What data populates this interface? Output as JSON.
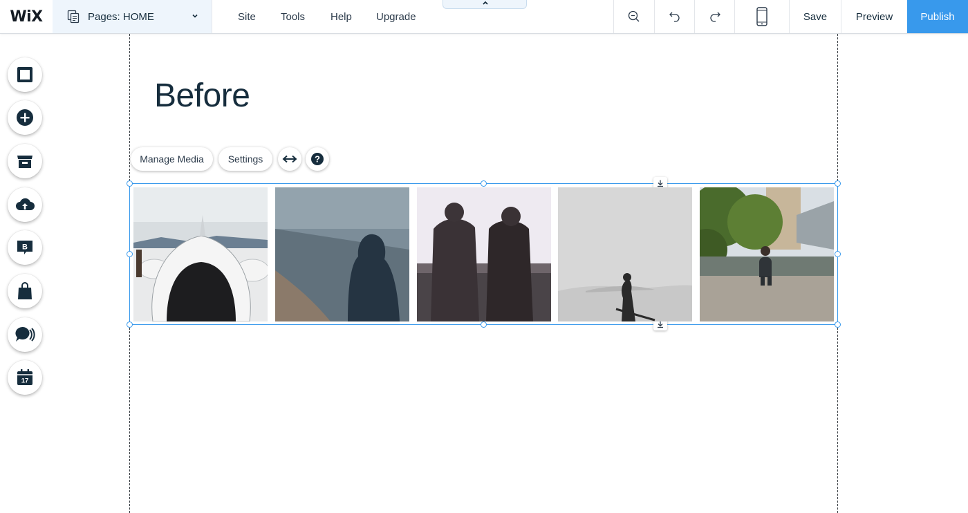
{
  "topbar": {
    "logo": "WiX",
    "pages_label": "Pages: HOME",
    "menu": {
      "site": "Site",
      "tools": "Tools",
      "help": "Help",
      "upgrade": "Upgrade"
    },
    "save": "Save",
    "preview": "Preview",
    "publish": "Publish"
  },
  "canvas": {
    "title": "Before"
  },
  "gallery_toolbar": {
    "manage_media": "Manage Media",
    "settings": "Settings"
  },
  "left_rail": {
    "icons": [
      "background-icon",
      "add-icon",
      "app-market-icon",
      "upload-icon",
      "blog-icon",
      "store-icon",
      "chat-icon",
      "bookings-icon"
    ]
  },
  "colors": {
    "accent": "#3899ec",
    "text": "#162d3d",
    "pages_bg": "#eef5fc"
  }
}
